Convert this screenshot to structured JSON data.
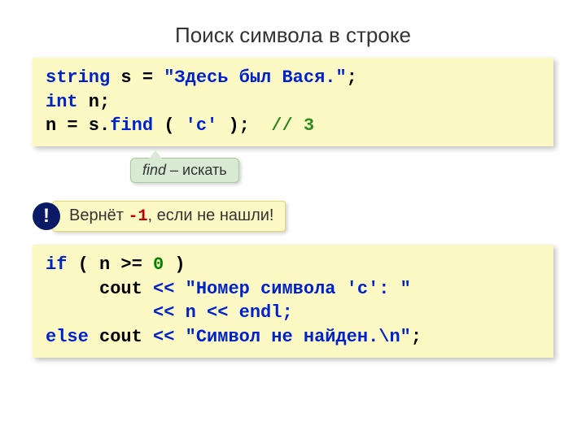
{
  "title": "Поиск символа в строке",
  "code1": {
    "l1a": "string",
    "l1b": " s = ",
    "l1c": "\"Здесь был Вася.\"",
    "l1d": ";",
    "l2a": "int",
    "l2b": " n;",
    "l3a": "n = s.",
    "l3b": "find",
    "l3c": " ( ",
    "l3d": "'с'",
    "l3e": " );  ",
    "l3f": "// 3"
  },
  "tooltip": {
    "word": "find",
    "rest": " – искать"
  },
  "bang": "!",
  "note": {
    "pre": "Вернёт ",
    "val": "-1",
    "post": ", если не нашли!"
  },
  "code2": {
    "l1a": "if",
    "l1b": " ( n >= ",
    "l1c": "0",
    "l1d": " ) ",
    "l2a": "     cout ",
    "l2b": "<< \"Номер символа 'c': \"",
    "l3a": "          ",
    "l3b": "<< n << endl;",
    "l4a": "else",
    "l4b": " cout ",
    "l4c": "<< \"Символ не найден.\\n\"",
    "l4d": ";"
  }
}
